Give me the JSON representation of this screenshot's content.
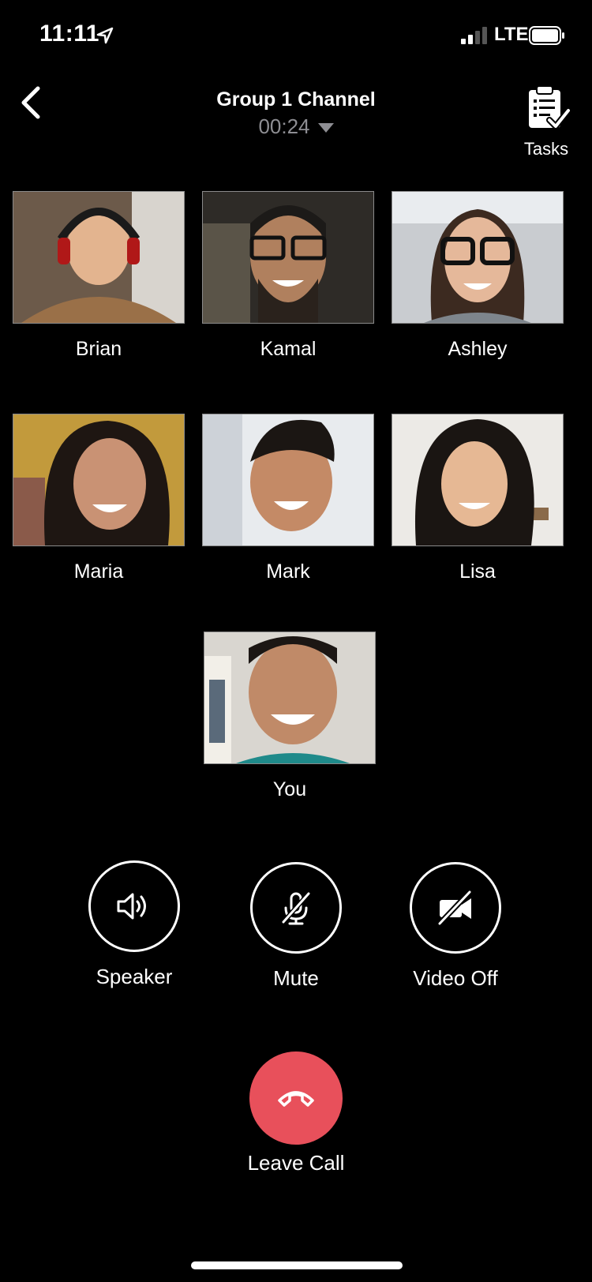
{
  "status_bar": {
    "time": "11:11",
    "location_icon": "location-arrow-icon",
    "signal_icon": "cellular-signal-icon",
    "network": "LTE",
    "battery_icon": "battery-icon"
  },
  "header": {
    "back_icon": "chevron-left-icon",
    "title": "Group 1 Channel",
    "duration": "00:24",
    "duration_caret_icon": "caret-down-icon",
    "tasks_icon": "clipboard-check-icon",
    "tasks_label": "Tasks"
  },
  "participants": [
    {
      "name": "Brian"
    },
    {
      "name": "Kamal"
    },
    {
      "name": "Ashley"
    },
    {
      "name": "Maria"
    },
    {
      "name": "Mark"
    },
    {
      "name": "Lisa"
    },
    {
      "name": "You"
    }
  ],
  "controls": {
    "speaker": {
      "label": "Speaker",
      "icon": "speaker-icon"
    },
    "mute": {
      "label": "Mute",
      "icon": "microphone-off-icon"
    },
    "video_off": {
      "label": "Video Off",
      "icon": "video-camera-off-icon"
    },
    "leave_call": {
      "label": "Leave Call",
      "icon": "phone-hangup-icon"
    }
  },
  "colors": {
    "background": "#000000",
    "leave_call": "#e8505b",
    "secondary_text": "#8e8e93"
  }
}
